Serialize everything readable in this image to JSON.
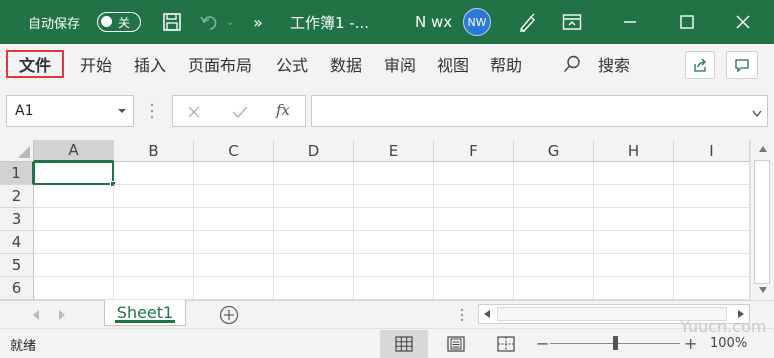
{
  "titlebar": {
    "autosave_label": "自动保存",
    "autosave_state": "关",
    "more": "»",
    "doc_title": "工作簿1  -...",
    "user_name": "N wx",
    "avatar_initials": "NW",
    "bg_color": "#217346"
  },
  "ribbon": {
    "tabs": [
      "文件",
      "开始",
      "插入",
      "页面布局",
      "公式",
      "数据",
      "审阅",
      "视图",
      "帮助"
    ],
    "search_label": "搜索"
  },
  "formula_bar": {
    "name_box": "A1",
    "fx": "fx",
    "formula_value": ""
  },
  "grid": {
    "columns": [
      "A",
      "B",
      "C",
      "D",
      "E",
      "F",
      "G",
      "H",
      "I"
    ],
    "rows": [
      "1",
      "2",
      "3",
      "4",
      "5",
      "6"
    ],
    "selected_cell": "A1"
  },
  "sheets": {
    "tabs": [
      "Sheet1"
    ],
    "active": "Sheet1"
  },
  "statusbar": {
    "status": "就绪",
    "zoom": "100%",
    "watermark": "Yuucn.com"
  }
}
